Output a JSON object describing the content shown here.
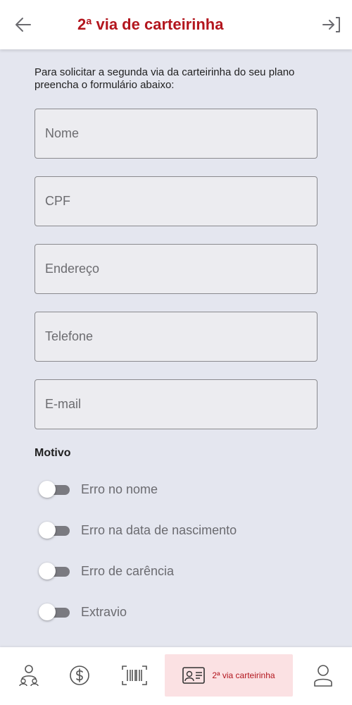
{
  "header": {
    "title": "2ª via de carteirinha",
    "back_icon": "arrow-left-icon",
    "exit_icon": "logout-icon"
  },
  "intro": {
    "text": "Para solicitar a segunda via da carteirinha do seu plano preencha o formulário abaixo:"
  },
  "form": {
    "fields": [
      {
        "name": "nome",
        "placeholder": "Nome",
        "value": ""
      },
      {
        "name": "cpf",
        "placeholder": "CPF",
        "value": ""
      },
      {
        "name": "endereco",
        "placeholder": "Endereço",
        "value": ""
      },
      {
        "name": "telefone",
        "placeholder": "Telefone",
        "value": ""
      },
      {
        "name": "email",
        "placeholder": "E-mail",
        "value": ""
      }
    ],
    "motivo_label": "Motivo",
    "motivos": [
      {
        "label": "Erro no nome",
        "checked": false
      },
      {
        "label": "Erro na data de nascimento",
        "checked": false
      },
      {
        "label": "Erro de carência",
        "checked": false
      },
      {
        "label": "Extravio",
        "checked": false
      }
    ]
  },
  "bottom_nav": {
    "items": [
      {
        "icon": "family-icon",
        "label": ""
      },
      {
        "icon": "dollar-icon",
        "label": ""
      },
      {
        "icon": "barcode-icon",
        "label": ""
      },
      {
        "icon": "id-card-icon",
        "label": "2ª via carteirinha",
        "active": true
      },
      {
        "icon": "user-icon",
        "label": ""
      }
    ]
  },
  "colors": {
    "accent": "#b3161e",
    "background": "#e4e6ef",
    "active_tab_bg": "#fbe1e3"
  }
}
